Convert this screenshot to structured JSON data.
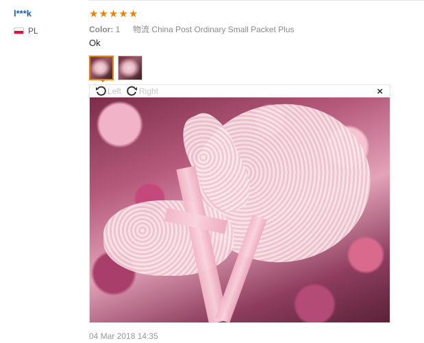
{
  "user": {
    "name": "l***k",
    "country_code": "PL",
    "flag_icon": "poland-flag-icon"
  },
  "review": {
    "rating": 5,
    "rating_max": 5,
    "star_color": "#f08200",
    "color_label": "Color:",
    "color_value": "1",
    "shipping_label": "物流",
    "shipping_value": "China Post Ordinary Small Packet Plus",
    "text": "Ok",
    "date": "04 Mar 2018 14:35"
  },
  "photos": {
    "thumbnail_count": 2,
    "active_index": 0
  },
  "viewer": {
    "rotate_left_label": "Left",
    "rotate_right_label": "Right",
    "close_glyph": "×"
  }
}
